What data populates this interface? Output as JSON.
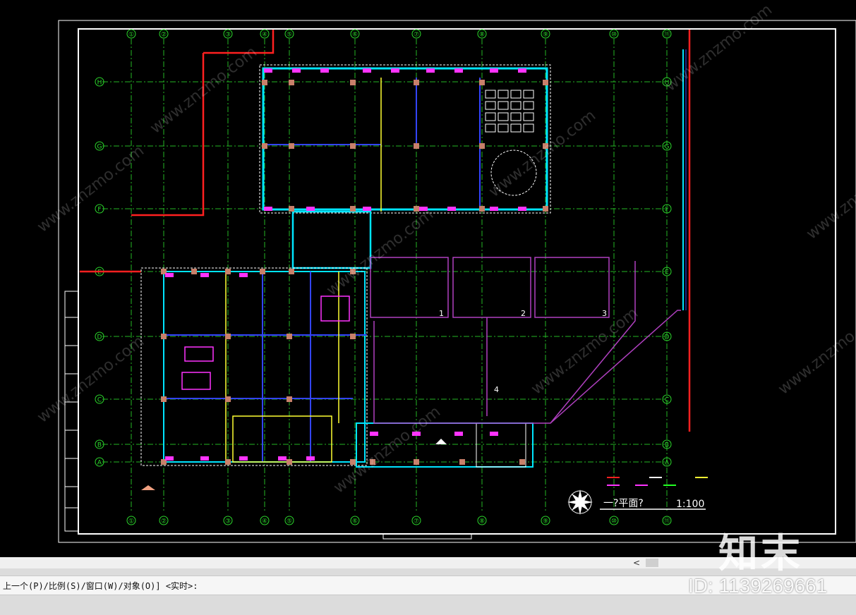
{
  "canvas": {
    "background": "#000000",
    "grid_columns": [
      "①",
      "②",
      "③",
      "④",
      "⑤",
      "⑥",
      "⑦",
      "⑧",
      "⑨",
      "⑩",
      "⑪"
    ],
    "grid_rows": [
      "H",
      "G",
      "F",
      "E",
      "D",
      "C",
      "B",
      "A"
    ],
    "zones": [
      "1",
      "2",
      "3",
      "4"
    ],
    "drawing_title": "一?平面?",
    "drawing_scale": "1:100",
    "colors": {
      "red": "#ff2020",
      "cyan": "#00e5ff",
      "green": "#22ff22",
      "yellow": "#ffff33",
      "magenta": "#ff33ff",
      "blue": "#3344ff",
      "white": "#ffffff",
      "purple": "#b040c0"
    }
  },
  "command_line": {
    "text": "上一个(P)/比例(S)/窗口(W)/对象(O)] <实时>:"
  },
  "watermark": {
    "brand": "知末",
    "id": "ID: 1139269661",
    "diagonal_text": "www.znzmo.com"
  },
  "scrollbar": {
    "arrow": "<"
  }
}
